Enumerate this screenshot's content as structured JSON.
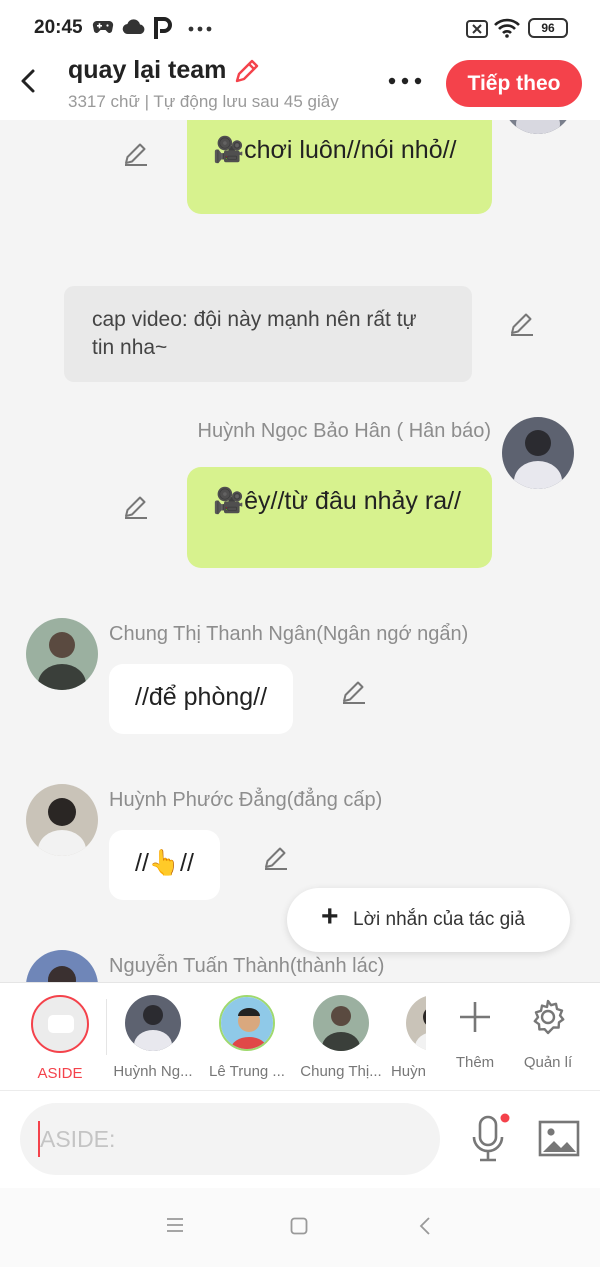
{
  "status_bar": {
    "time": "20:45",
    "battery": "96"
  },
  "header": {
    "title": "quay lại team",
    "subtitle": "3317 chữ | Tự động lưu sau 45 giây",
    "next_label": "Tiếp theo"
  },
  "messages": [
    {
      "type": "right",
      "text": "🎥chơi luôn//nói nhỏ//"
    },
    {
      "type": "narration",
      "text": "cap video: đội này mạnh nên rất tự tin nha~"
    },
    {
      "type": "right",
      "sender": "Huỳnh Ngọc Bảo Hân ( Hân báo)",
      "text": "🎥êy//từ đâu nhảy ra//"
    },
    {
      "type": "left",
      "sender": "Chung Thị Thanh Ngân(Ngân ngớ ngẩn)",
      "text": "//để phòng//"
    },
    {
      "type": "left",
      "sender": "Huỳnh Phước Đẳng(đẳng cấp)",
      "text": "//👆//"
    },
    {
      "type": "left",
      "sender": "Nguyễn Tuấn Thành(thành lác)"
    }
  ],
  "author_note": {
    "label": "Lời nhắn của tác giả"
  },
  "characters": [
    {
      "name": "ASIDE"
    },
    {
      "name": "Huỳnh Ng..."
    },
    {
      "name": "Lê Trung ..."
    },
    {
      "name": "Chung Thị..."
    },
    {
      "name": "Huỳn"
    }
  ],
  "actions": {
    "add_label": "Thêm",
    "manage_label": "Quản lí"
  },
  "input": {
    "placeholder": "ASIDE:"
  },
  "colors": {
    "accent": "#f4424b",
    "bubble_green": "#d7f28e",
    "background": "#f4f4f4"
  }
}
